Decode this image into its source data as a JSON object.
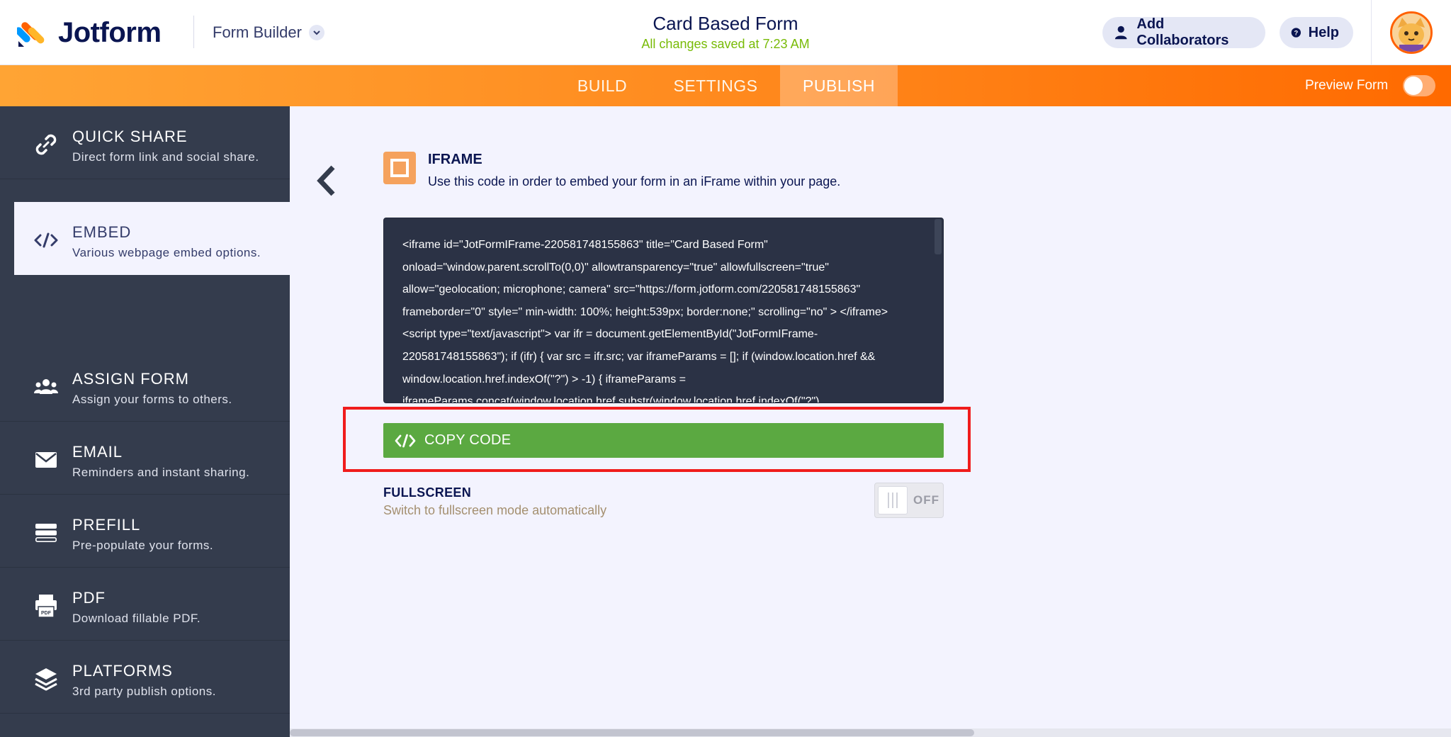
{
  "header": {
    "logo_text": "Jotform",
    "builder_label": "Form Builder",
    "form_title": "Card Based Form",
    "save_status": "All changes saved at 7:23 AM",
    "collaborators_label": "Add Collaborators",
    "help_label": "Help"
  },
  "nav": {
    "tabs": [
      {
        "label": "BUILD",
        "active": false
      },
      {
        "label": "SETTINGS",
        "active": false
      },
      {
        "label": "PUBLISH",
        "active": true
      }
    ],
    "preview_label": "Preview Form",
    "preview_on": false
  },
  "sidebar": {
    "items": [
      {
        "title": "QUICK SHARE",
        "subtitle": "Direct form link and social share.",
        "icon": "link-icon"
      },
      {
        "title": "EMBED",
        "subtitle": "Various webpage embed options.",
        "icon": "code-icon",
        "active": true
      },
      {
        "title": "ASSIGN FORM",
        "subtitle": "Assign your forms to others.",
        "icon": "users-icon"
      },
      {
        "title": "EMAIL",
        "subtitle": "Reminders and instant sharing.",
        "icon": "envelope-icon"
      },
      {
        "title": "PREFILL",
        "subtitle": "Pre-populate your forms.",
        "icon": "prefill-icon"
      },
      {
        "title": "PDF",
        "subtitle": "Download fillable PDF.",
        "icon": "pdf-icon"
      },
      {
        "title": "PLATFORMS",
        "subtitle": "3rd party publish options.",
        "icon": "layers-icon"
      }
    ]
  },
  "main": {
    "section_title": "IFRAME",
    "section_desc": "Use this code in order to embed your form in an iFrame within your page.",
    "code": " <iframe id=\"JotFormIFrame-220581748155863\" title=\"Card Based Form\" onload=\"window.parent.scrollTo(0,0)\" allowtransparency=\"true\" allowfullscreen=\"true\" allow=\"geolocation; microphone; camera\" src=\"https://form.jotform.com/220581748155863\" frameborder=\"0\" style=\" min-width: 100%; height:539px; border:none;\" scrolling=\"no\" > </iframe> <script type=\"text/javascript\"> var ifr = document.getElementById(\"JotFormIFrame-220581748155863\"); if (ifr) { var src = ifr.src; var iframeParams = []; if (window.location.href && window.location.href.indexOf(\"?\") > -1) { iframeParams = iframeParams.concat(window.location.href.substr(window.location.href.indexOf(\"?\")",
    "copy_label": "COPY CODE",
    "fullscreen_title": "FULLSCREEN",
    "fullscreen_desc": "Switch to fullscreen mode automatically",
    "fullscreen_state": "OFF"
  },
  "colors": {
    "accent_orange": "#ff6100",
    "copy_green": "#5ba941",
    "highlight_red": "#f01c1c",
    "sidebar_bg": "#343c4d"
  }
}
